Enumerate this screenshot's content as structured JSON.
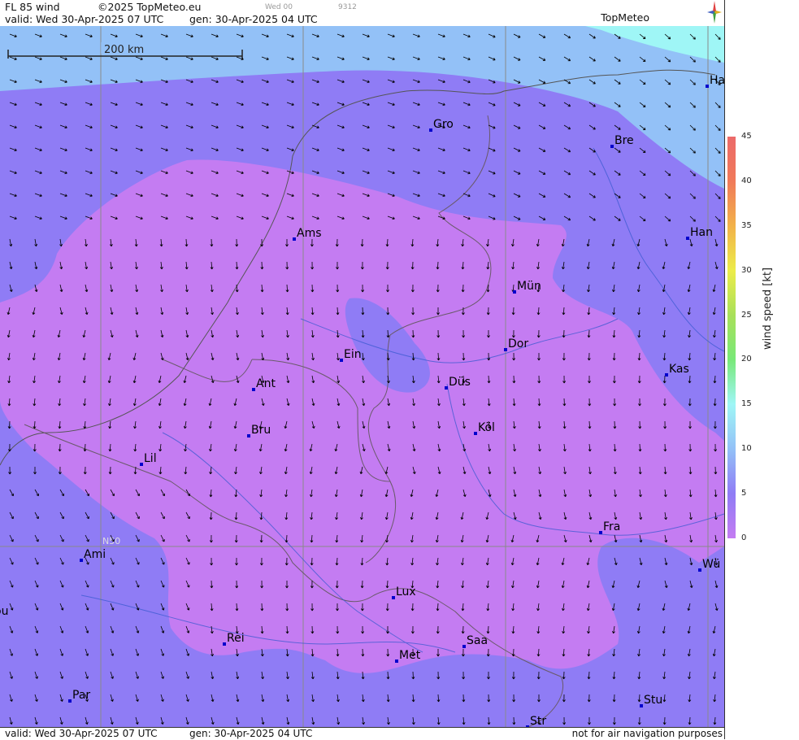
{
  "header": {
    "product": "FL 85 wind",
    "copyright": "©2025 TopMeteo.eu",
    "valid_day": "Wed 00",
    "code": "9312",
    "valid": "valid:  Wed  30-Apr-2025  07 UTC",
    "gen": "gen: 30-Apr-2025 04 UTC",
    "logo": "TopMeteo"
  },
  "scale_bar": {
    "label": "200 km"
  },
  "lat_label": "N50",
  "cities": [
    {
      "name": "Gro"
    },
    {
      "name": "Bre"
    },
    {
      "name": "Ha"
    },
    {
      "name": "Ams"
    },
    {
      "name": "Han"
    },
    {
      "name": "Mün"
    },
    {
      "name": "Dor"
    },
    {
      "name": "Ein"
    },
    {
      "name": "Kas"
    },
    {
      "name": "Düs"
    },
    {
      "name": "Ant"
    },
    {
      "name": "Bru"
    },
    {
      "name": "Köl"
    },
    {
      "name": "Lil"
    },
    {
      "name": "Fra"
    },
    {
      "name": "Ami"
    },
    {
      "name": "Wü"
    },
    {
      "name": "Lux"
    },
    {
      "name": "ou"
    },
    {
      "name": "Rei"
    },
    {
      "name": "Saa"
    },
    {
      "name": "Met"
    },
    {
      "name": "Par"
    },
    {
      "name": "Stu"
    },
    {
      "name": "Str"
    }
  ],
  "footer": {
    "valid": "valid:  Wed  30-Apr-2025  07 UTC",
    "gen": "gen: 30-Apr-2025 04 UTC",
    "disclaimer": "not for air navigation purposes"
  },
  "legend": {
    "title": "wind speed  [kt]",
    "ticks": [
      "45",
      "40",
      "35",
      "30",
      "25",
      "20",
      "15",
      "10",
      "5",
      "0"
    ],
    "colors": [
      "#c47cf2",
      "#8f7cf5",
      "#93c1f7",
      "#9ff6f6",
      "#78e878",
      "#a8e05a",
      "#ecec4a",
      "#f2b24a",
      "#f07a5a",
      "#ec6a6a"
    ]
  }
}
